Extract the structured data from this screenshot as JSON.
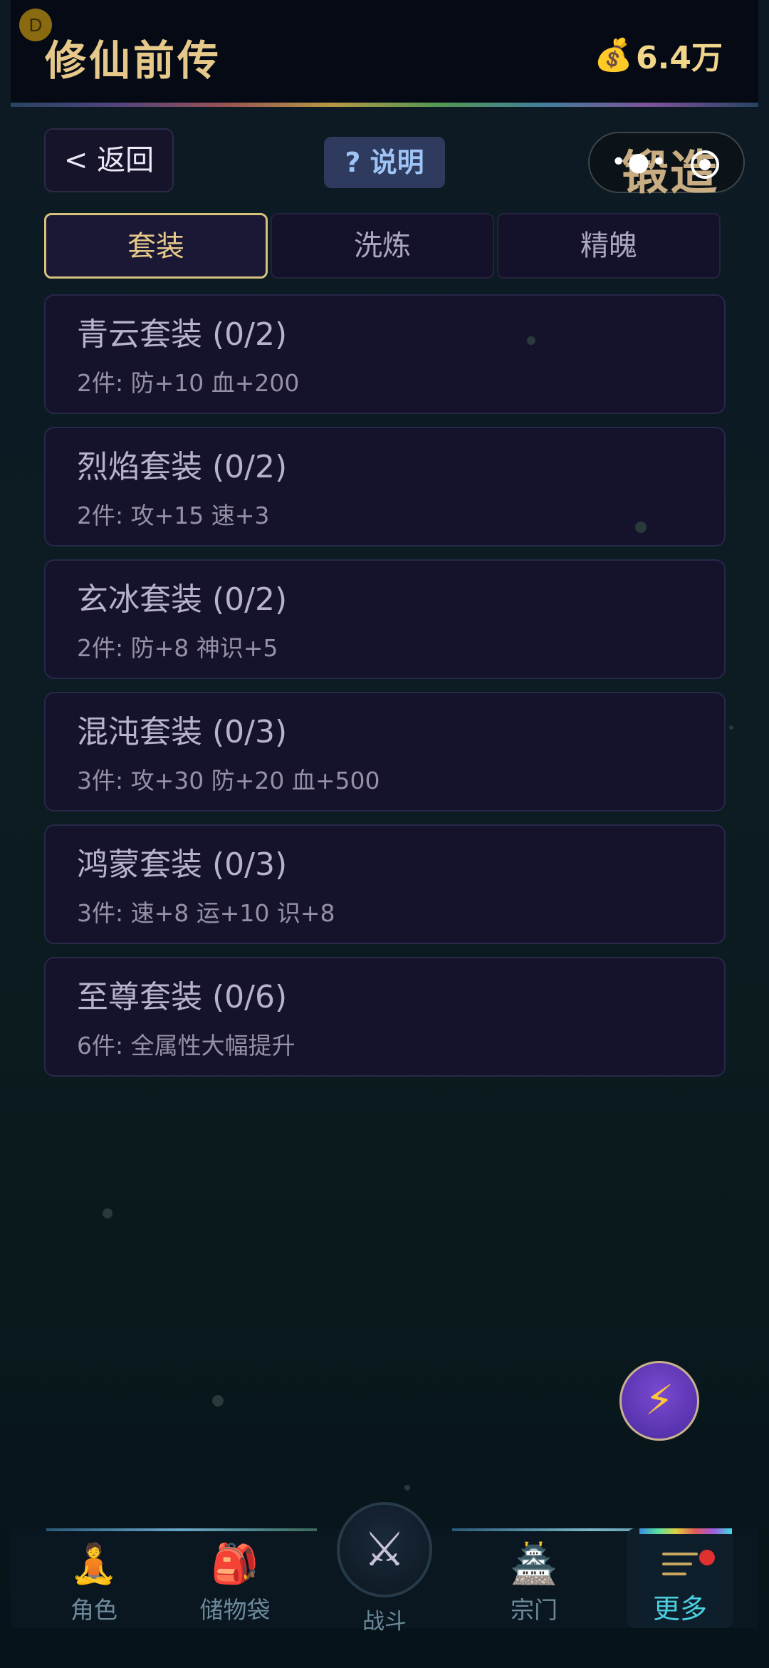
{
  "header": {
    "avatar_letter": "D",
    "title": "修仙前传",
    "coin_icon": "money-bag-icon",
    "coins": "6.4万"
  },
  "toolbar": {
    "back_label": "< 返回",
    "help_label": "? 说明",
    "capsule_text": "锻造"
  },
  "tabs": [
    {
      "label": "套装",
      "active": true
    },
    {
      "label": "洗炼",
      "active": false
    },
    {
      "label": "精魄",
      "active": false
    }
  ],
  "sets": [
    {
      "name": "青云套装 (0/2)",
      "bonus": "2件: 防+10 血+200"
    },
    {
      "name": "烈焰套装 (0/2)",
      "bonus": "2件: 攻+15 速+3"
    },
    {
      "name": "玄冰套装 (0/2)",
      "bonus": "2件: 防+8 神识+5"
    },
    {
      "name": "混沌套装 (0/3)",
      "bonus": "3件: 攻+30 防+20 血+500"
    },
    {
      "name": "鸿蒙套装 (0/3)",
      "bonus": "3件: 速+8 运+10 识+8"
    },
    {
      "name": "至尊套装 (0/6)",
      "bonus": "6件: 全属性大幅提升"
    }
  ],
  "fab": {
    "icon": "lightning-icon",
    "symbol": "⚡"
  },
  "nav": {
    "items": [
      {
        "label": "角色",
        "icon": "meditating-figure-icon",
        "symbol": "🧘"
      },
      {
        "label": "储物袋",
        "icon": "storage-bag-icon",
        "symbol": "🎒"
      },
      {
        "label": "宗门",
        "icon": "temple-icon",
        "symbol": "🏯"
      },
      {
        "label": "更多",
        "icon": "menu-icon"
      }
    ],
    "battle": {
      "label": "战斗",
      "icon": "crossed-swords-icon",
      "symbol": "⚔"
    }
  }
}
